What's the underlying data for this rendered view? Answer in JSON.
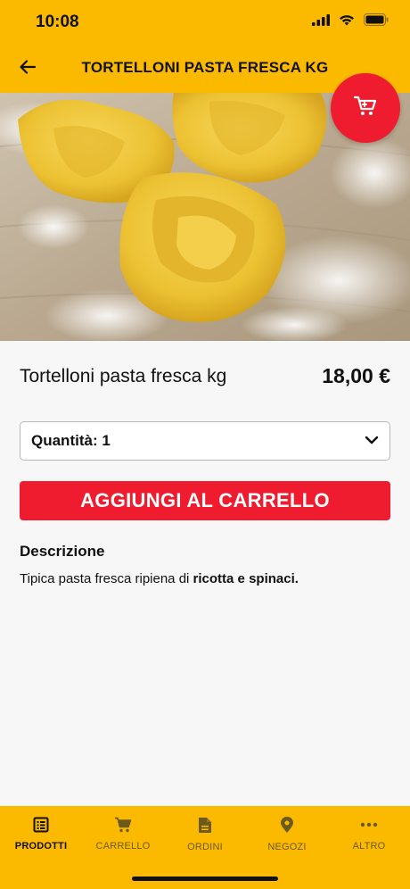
{
  "status_bar": {
    "time": "10:08"
  },
  "header": {
    "title": "TORTELLONI PASTA FRESCA KG"
  },
  "product": {
    "name": "Tortelloni pasta fresca kg",
    "price": "18,00 €",
    "quantity_label": "Quantità: 1"
  },
  "actions": {
    "add_to_cart_label": "AGGIUNGI AL CARRELLO"
  },
  "description": {
    "heading": "Descrizione",
    "text_prefix": "Tipica pasta fresca ripiena di ",
    "text_bold": "ricotta e spinaci."
  },
  "tabs": [
    {
      "label": "PRODOTTI",
      "icon": "list-icon",
      "active": true
    },
    {
      "label": "CARRELLO",
      "icon": "cart-icon",
      "active": false
    },
    {
      "label": "ORDINI",
      "icon": "document-icon",
      "active": false
    },
    {
      "label": "NEGOZI",
      "icon": "location-pin-icon",
      "active": false
    },
    {
      "label": "ALTRO",
      "icon": "more-dots-icon",
      "active": false
    }
  ],
  "colors": {
    "brand_yellow": "#fbb900",
    "accent_red": "#ee1c2e"
  }
}
